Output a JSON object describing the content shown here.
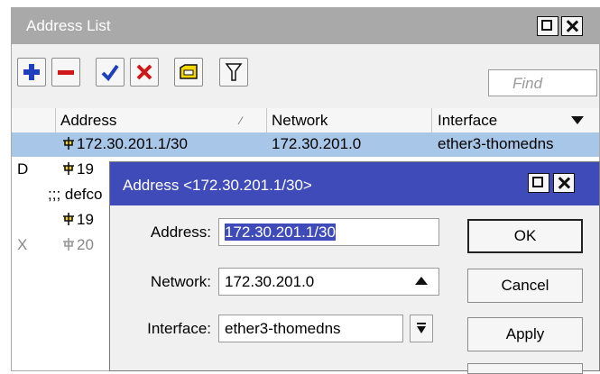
{
  "window": {
    "title": "Address List"
  },
  "toolbar": {
    "buttons": [
      {
        "icon": "plus-icon"
      },
      {
        "icon": "minus-icon"
      },
      {
        "icon": "check-icon"
      },
      {
        "icon": "cross-icon"
      },
      {
        "icon": "comment-icon"
      },
      {
        "icon": "filter-icon"
      }
    ],
    "find_placeholder": "Find"
  },
  "table": {
    "columns": [
      "Address",
      "Network",
      "Interface"
    ],
    "rows": [
      {
        "flag": "",
        "address": "172.30.201.1/30",
        "network": "172.30.201.0",
        "interface": "ether3-thomedns",
        "selected": true
      },
      {
        "flag": "D",
        "address": "19",
        "network": "",
        "interface": ""
      },
      {
        "comment": ";;; defco"
      },
      {
        "flag": "",
        "address": "19",
        "network": "",
        "interface": ""
      },
      {
        "flag": "X",
        "address": "20",
        "network": "",
        "interface": "",
        "disabled": true
      }
    ]
  },
  "dialog": {
    "title": "Address <172.30.201.1/30>",
    "address_label": "Address:",
    "address_value": "172.30.201.1/30",
    "network_label": "Network:",
    "network_value": "172.30.201.0",
    "interface_label": "Interface:",
    "interface_value": "ether3-thomedns",
    "ok": "OK",
    "cancel": "Cancel",
    "apply": "Apply"
  },
  "colors": {
    "title_gray": "#a9a9a9",
    "dialog_blue": "#3f4bb8",
    "selection": "#a7c6e8",
    "add_blue": "#1f3fbf",
    "remove_red": "#d01818",
    "icon_yellow": "#f5d800"
  }
}
